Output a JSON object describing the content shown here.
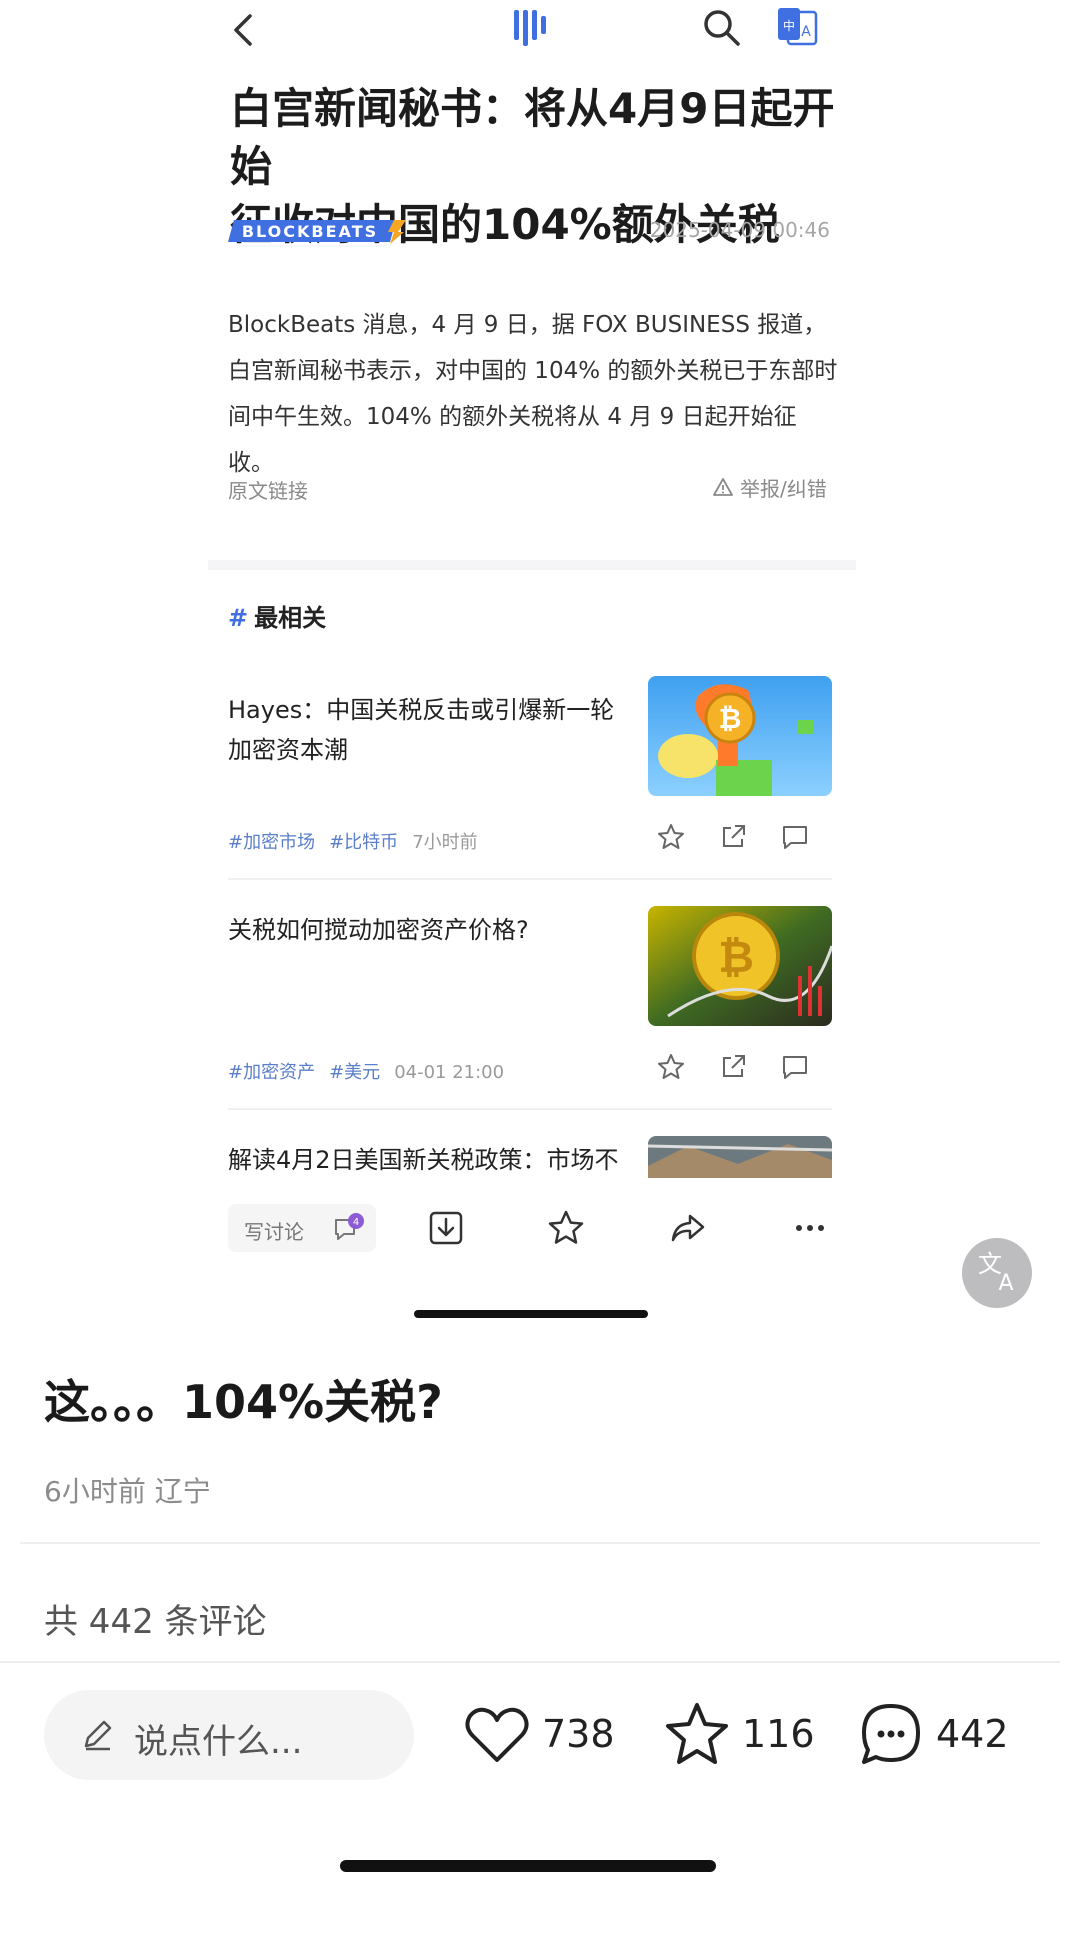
{
  "article": {
    "headline_line1": "白宫新闻秘书：将从4月9日起开始",
    "headline_line2": "征收对中国的104%额外关税",
    "brand": "BLOCKBEATS",
    "date": "2025-04-09 00:46",
    "body_line1": "BlockBeats 消息，4 月 9 日，据 FOX BUSINESS 报道，",
    "body_line2": "白宫新闻秘书表示，对中国的 104% 的额外关税已于东部时",
    "body_line3": "间中午生效。104% 的额外关税将从 4 月 9 日起开始征收。",
    "original_link": "原文链接",
    "report": "举报/纠错"
  },
  "related": {
    "title": "最相关",
    "items": [
      {
        "title_line1": "Hayes：中国关税反击或引爆新一轮",
        "title_line2": "加密资本潮",
        "tags": [
          "#加密市场",
          "#比特币"
        ],
        "time": "7小时前"
      },
      {
        "title_line1": "关税如何搅动加密资产价格?",
        "title_line2": "",
        "tags": [
          "#加密资产",
          "#美元"
        ],
        "time": "04-01 21:00"
      },
      {
        "title_line1": "解读4月2日美国新关税政策：市场不",
        "title_line2": "",
        "tags": [],
        "time": ""
      }
    ]
  },
  "toolbar": {
    "write_comment": "写讨论"
  },
  "post": {
    "title": "这。。。104%关税?",
    "meta": "6小时前 辽宁",
    "comment_count_text": "共 442 条评论"
  },
  "bottom_bar": {
    "input_placeholder": "说点什么...",
    "likes": "738",
    "favorites": "116",
    "comments": "442"
  },
  "colors": {
    "accent_blue": "#3f6fe0",
    "brand_orange": "#f5a623",
    "tag_blue": "#5b7ec9"
  }
}
